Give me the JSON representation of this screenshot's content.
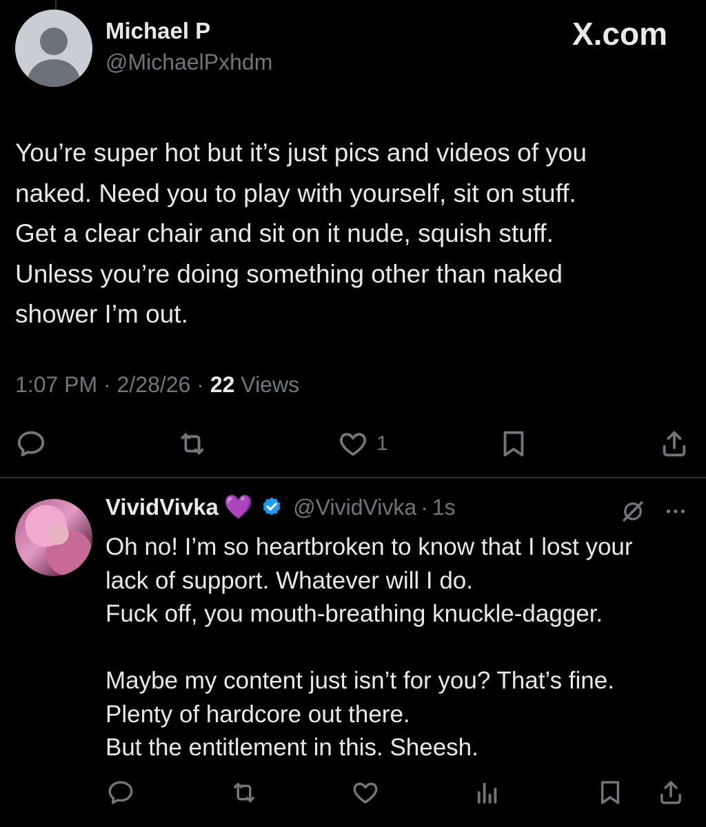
{
  "brand": {
    "label": "X.com"
  },
  "tweet": {
    "author_name": "Michael P",
    "author_handle": "@MichaelPxhdm",
    "body_lines": [
      "You’re super hot but it’s just pics and videos of you",
      "naked. Need you to play with yourself, sit on stuff.",
      "Get a clear chair and sit on it nude, squish stuff.",
      "Unless you’re doing something other than naked",
      "shower I’m out."
    ],
    "time": "1:07 PM",
    "date": "2/28/26",
    "views_count": "22",
    "views_label": "Views",
    "like_count": "1",
    "actions": [
      "reply-icon",
      "repost-icon",
      "like-icon",
      "bookmark-icon",
      "share-icon"
    ]
  },
  "reply": {
    "author_name": "VividVivka",
    "emoji": "💜",
    "author_handle": "@VividVivka",
    "time": "1s",
    "paragraphs": [
      [
        "Oh no! I’m so heartbroken to know that I lost your",
        "lack of support. Whatever will I do.",
        "Fuck off, you mouth-breathing knuckle-dagger."
      ],
      [
        "Maybe my content just isn’t for you? That’s fine.",
        "Plenty of hardcore out there.",
        "But the entitlement in this. Sheesh."
      ]
    ],
    "actions": [
      "reply-icon",
      "repost-icon",
      "like-icon",
      "views-icon",
      "bookmark-icon",
      "share-icon"
    ]
  },
  "colors": {
    "background": "#000000",
    "text": "#e7e9ea",
    "muted": "#71767b",
    "divider": "#2f3336",
    "verified": "#1d9bf0"
  }
}
